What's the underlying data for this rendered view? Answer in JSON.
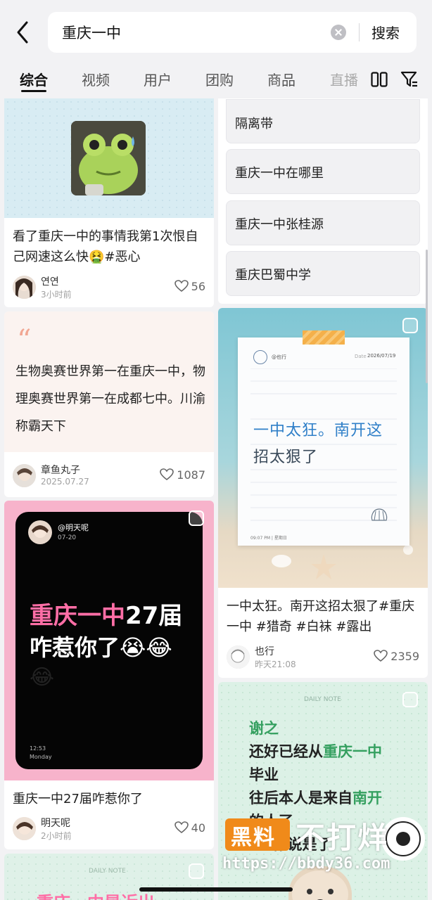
{
  "search": {
    "query": "重庆一中",
    "button_label": "搜索"
  },
  "tabs": [
    {
      "label": "综合",
      "active": true
    },
    {
      "label": "视频"
    },
    {
      "label": "用户"
    },
    {
      "label": "团购"
    },
    {
      "label": "商品"
    },
    {
      "label": "直播"
    }
  ],
  "suggestions": [
    "隔离带",
    "重庆一中在哪里",
    "重庆一中张桂源",
    "重庆巴蜀中学"
  ],
  "cards": {
    "frog": {
      "title": "看了重庆一中的事情我第1次恨自己网速这么快🤮#恶心",
      "author": "연연",
      "time": "3小时前",
      "likes": "56"
    },
    "quote": {
      "quote_text": "生物奥赛世界第一在重庆一中，物理奥赛世界第一在成都七中。川渝称霸天下",
      "author": "章鱼丸子",
      "time": "2025.07.27",
      "likes": "1087"
    },
    "note": {
      "note_user": "@也行",
      "note_date": "2026/07/19",
      "note_date_label": "Date",
      "note_text_1": "一中太狂。南开这",
      "note_text_2": "招太狠了",
      "note_footer": "09:07 PM | 星期日",
      "title": "一中太狂。南开这招太狠了#重庆一中 #猎奇 #白袜 #露出",
      "author": "也行",
      "time": "昨天21:08",
      "likes": "2359"
    },
    "black": {
      "handle": "@明天呢",
      "date": "07-20",
      "line1_highlight": "重庆一中",
      "line1_rest": "27届",
      "line2": "咋惹你了😭😂",
      "line3": "😂",
      "clock": "12:53",
      "day": "Monday",
      "title": "重庆一中27届咋惹你了",
      "author": "明天呢",
      "time": "2小时前",
      "likes": "40"
    },
    "daily": {
      "header": "DAILY NOTE",
      "line_a": "谢之",
      "line_b1": "还好已经从",
      "line_b2": "重庆一中",
      "line_c": "毕业",
      "line_d1": "往后本人是来自",
      "line_d2": "南开",
      "line_e": "的人了",
      "line_f": "c　你说是了"
    },
    "bottom_left": {
      "header": "DAILY NOTE",
      "text": "重庆一中是近出"
    }
  },
  "watermark": {
    "text1": "黑料",
    "text2": "不打烊",
    "url": "https://bbdy36.com"
  },
  "colors": {
    "accent_pink": "#ff6ea6",
    "green_text": "#35a060",
    "brand_orange": "#f08a1a"
  }
}
